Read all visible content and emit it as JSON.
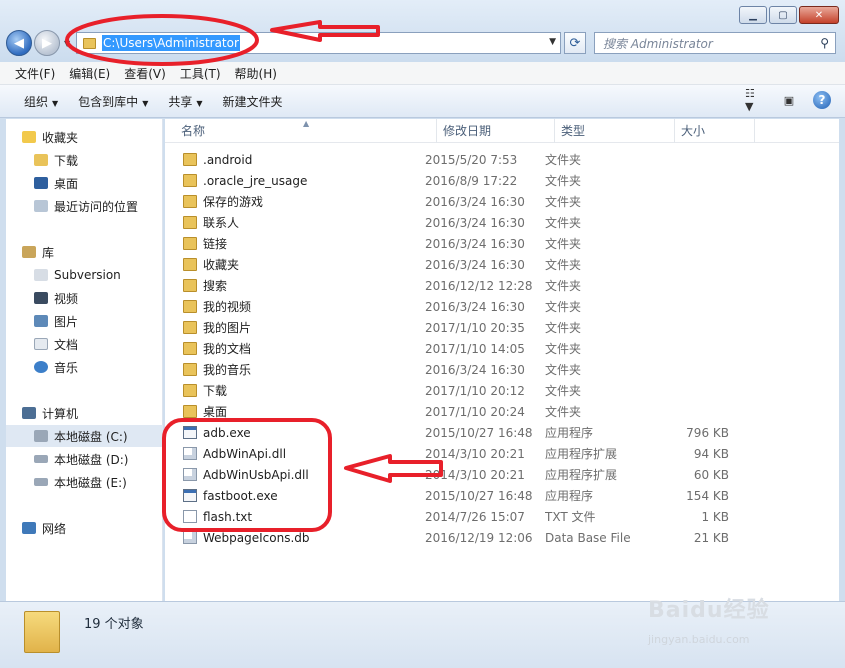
{
  "address": {
    "path": "C:\\Users\\Administrator"
  },
  "search": {
    "placeholder": "搜索 Administrator"
  },
  "menu": [
    "文件(F)",
    "编辑(E)",
    "查看(V)",
    "工具(T)",
    "帮助(H)"
  ],
  "toolbar": {
    "organize": "组织",
    "include": "包含到库中",
    "share": "共享",
    "new_folder": "新建文件夹"
  },
  "nav": {
    "favorites": "收藏夹",
    "downloads": "下载",
    "desktop": "桌面",
    "recent": "最近访问的位置",
    "libraries": "库",
    "subversion": "Subversion",
    "videos": "视频",
    "pictures": "图片",
    "documents": "文档",
    "music": "音乐",
    "computer": "计算机",
    "disk_c": "本地磁盘 (C:)",
    "disk_d": "本地磁盘 (D:)",
    "disk_e": "本地磁盘 (E:)",
    "network": "网络"
  },
  "columns": {
    "name": "名称",
    "date": "修改日期",
    "type": "类型",
    "size": "大小"
  },
  "files": [
    {
      "name": ".android",
      "date": "2015/5/20 7:53",
      "type": "文件夹",
      "size": "",
      "icon": "folder"
    },
    {
      "name": ".oracle_jre_usage",
      "date": "2016/8/9 17:22",
      "type": "文件夹",
      "size": "",
      "icon": "folder"
    },
    {
      "name": "保存的游戏",
      "date": "2016/3/24 16:30",
      "type": "文件夹",
      "size": "",
      "icon": "folder"
    },
    {
      "name": "联系人",
      "date": "2016/3/24 16:30",
      "type": "文件夹",
      "size": "",
      "icon": "folder"
    },
    {
      "name": "链接",
      "date": "2016/3/24 16:30",
      "type": "文件夹",
      "size": "",
      "icon": "folder"
    },
    {
      "name": "收藏夹",
      "date": "2016/3/24 16:30",
      "type": "文件夹",
      "size": "",
      "icon": "folder"
    },
    {
      "name": "搜索",
      "date": "2016/12/12 12:28",
      "type": "文件夹",
      "size": "",
      "icon": "folder"
    },
    {
      "name": "我的视频",
      "date": "2016/3/24 16:30",
      "type": "文件夹",
      "size": "",
      "icon": "folder"
    },
    {
      "name": "我的图片",
      "date": "2017/1/10 20:35",
      "type": "文件夹",
      "size": "",
      "icon": "folder"
    },
    {
      "name": "我的文档",
      "date": "2017/1/10 14:05",
      "type": "文件夹",
      "size": "",
      "icon": "folder"
    },
    {
      "name": "我的音乐",
      "date": "2016/3/24 16:30",
      "type": "文件夹",
      "size": "",
      "icon": "folder"
    },
    {
      "name": "下载",
      "date": "2017/1/10 20:12",
      "type": "文件夹",
      "size": "",
      "icon": "folder"
    },
    {
      "name": "桌面",
      "date": "2017/1/10 20:24",
      "type": "文件夹",
      "size": "",
      "icon": "folder"
    },
    {
      "name": "adb.exe",
      "date": "2015/10/27 16:48",
      "type": "应用程序",
      "size": "796 KB",
      "icon": "exe"
    },
    {
      "name": "AdbWinApi.dll",
      "date": "2014/3/10 20:21",
      "type": "应用程序扩展",
      "size": "94 KB",
      "icon": "dll"
    },
    {
      "name": "AdbWinUsbApi.dll",
      "date": "2014/3/10 20:21",
      "type": "应用程序扩展",
      "size": "60 KB",
      "icon": "dll"
    },
    {
      "name": "fastboot.exe",
      "date": "2015/10/27 16:48",
      "type": "应用程序",
      "size": "154 KB",
      "icon": "exe"
    },
    {
      "name": "flash.txt",
      "date": "2014/7/26 15:07",
      "type": "TXT 文件",
      "size": "1 KB",
      "icon": "doc"
    },
    {
      "name": "WebpageIcons.db",
      "date": "2016/12/19 12:06",
      "type": "Data Base File",
      "size": "21 KB",
      "icon": "dll"
    }
  ],
  "status": {
    "count": "19 个对象"
  },
  "watermark": {
    "brand": "Baidu经验",
    "url": "jingyan.baidu.com"
  },
  "colors": {
    "annotation": "#e8202a",
    "selection": "#3399ff"
  }
}
